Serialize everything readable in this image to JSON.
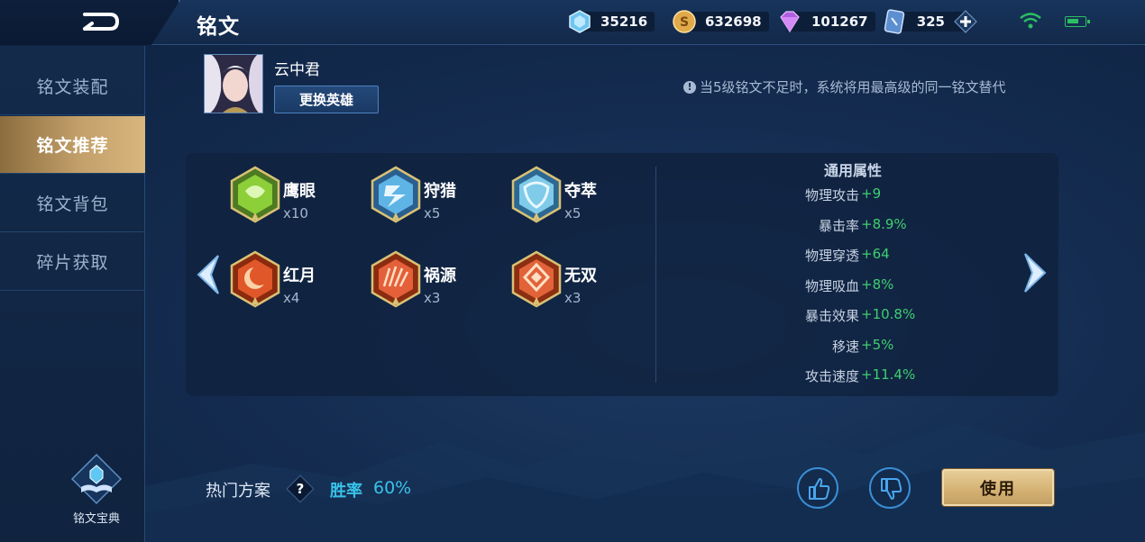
{
  "header": {
    "title": "铭文",
    "resources": [
      {
        "icon": "diamond-icon",
        "value": "35216"
      },
      {
        "icon": "gold-coin-icon",
        "value": "632698"
      },
      {
        "icon": "crystal-icon",
        "value": "101267"
      },
      {
        "icon": "rune-card-icon",
        "value": "325"
      }
    ]
  },
  "sidebar": {
    "items": [
      {
        "label": "铭文装配",
        "active": false
      },
      {
        "label": "铭文推荐",
        "active": true
      },
      {
        "label": "铭文背包",
        "active": false
      },
      {
        "label": "碎片获取",
        "active": false
      }
    ],
    "codex_label": "铭文宝典"
  },
  "hero": {
    "name": "云中君",
    "change_button": "更换英雄"
  },
  "notice": "当5级铭文不足时，系统将用最高级的同一铭文替代",
  "runes": [
    {
      "name": "鹰眼",
      "count": "x10",
      "color": "#6fae2f",
      "icon": "eagle-eye-rune-icon"
    },
    {
      "name": "狩猎",
      "count": "x5",
      "color": "#3f8fc9",
      "icon": "hunt-rune-icon"
    },
    {
      "name": "夺萃",
      "count": "x5",
      "color": "#4aa0cf",
      "icon": "plunder-rune-icon"
    },
    {
      "name": "红月",
      "count": "x4",
      "color": "#d2501f",
      "icon": "red-moon-rune-icon"
    },
    {
      "name": "祸源",
      "count": "x3",
      "color": "#d5552a",
      "icon": "calamity-rune-icon"
    },
    {
      "name": "无双",
      "count": "x3",
      "color": "#d4582c",
      "icon": "peerless-rune-icon"
    }
  ],
  "attributes": {
    "title": "通用属性",
    "rows": [
      {
        "label": "物理攻击",
        "value": "+9"
      },
      {
        "label": "暴击率",
        "value": "+8.9%"
      },
      {
        "label": "物理穿透",
        "value": "+64"
      },
      {
        "label": "物理吸血",
        "value": "+8%"
      },
      {
        "label": "暴击效果",
        "value": "+10.8%"
      },
      {
        "label": "移速",
        "value": "+5%"
      },
      {
        "label": "攻击速度",
        "value": "+11.4%"
      }
    ]
  },
  "footer": {
    "hot_plan_label": "热门方案",
    "help_label": "?",
    "winrate_label": "胜率",
    "winrate_value": "60%",
    "use_button": "使用"
  },
  "colors": {
    "accent_gold": "#d4b173",
    "positive_green": "#3fcf6f",
    "winrate_blue": "#39c2e8"
  }
}
